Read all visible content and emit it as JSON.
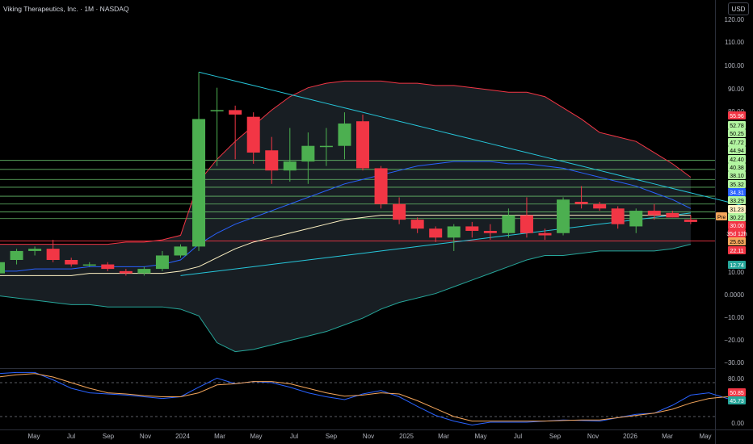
{
  "header": {
    "title": "Viking Therapeutics, Inc. · 1M · NASDAQ",
    "currency_label": "USD"
  },
  "price_axis": {
    "ticks": [
      "120.00",
      "110.00",
      "100.00",
      "90.00",
      "80.00",
      "10.00",
      "0.0000",
      "−10.00",
      "−20.00",
      "−30.00"
    ],
    "levels": [
      {
        "label": "55.96",
        "value": 79.5,
        "color": "#f23645"
      },
      {
        "label": "52.78",
        "value": 76.0,
        "color": "#b2f5a0"
      },
      {
        "label": "50.25",
        "value": 73.0,
        "color": "#b2f5a0"
      },
      {
        "label": "47.72",
        "value": 70.0,
        "color": "#b2f5a0"
      },
      {
        "label": "44.94",
        "value": 66.0,
        "color": "#b2f5a0"
      },
      {
        "label": "42.40",
        "value": 62.5,
        "color": "#b2f5a0"
      },
      {
        "label": "40.38",
        "value": 59.2,
        "color": "#b2f5a0"
      },
      {
        "label": "38.10",
        "value": 55.7,
        "color": "#b2f5a0"
      },
      {
        "label": "35.32",
        "value": 52.3,
        "color": "#b2f5a0"
      },
      {
        "label": "34.31",
        "value": 48.8,
        "color": "#2962ff"
      },
      {
        "label": "33.29",
        "value": 45.3,
        "color": "#b2f5a0"
      },
      {
        "label": "31.23",
        "value": 41.8,
        "color": "#fff3c4"
      },
      {
        "label": "30.22",
        "value": 38.0,
        "color": "#b2f5a0"
      },
      {
        "label": "30.00",
        "value": 35.0,
        "color": "#f23645"
      },
      {
        "label": "35d 12h",
        "value": 32.0,
        "color": "#f23645"
      },
      {
        "label": "25.63",
        "value": 28.0,
        "color": "#f5a65b"
      },
      {
        "label": "22.11",
        "value": 23.5,
        "color": "#f23645"
      },
      {
        "label": "12.74",
        "value": 13.5,
        "color": "#26a69a"
      }
    ],
    "pre_label": "Pre"
  },
  "oscillator_axis": {
    "ticks": [
      "80.00",
      "0.00"
    ],
    "levels": [
      {
        "label": "50.85",
        "color": "#f23645"
      },
      {
        "label": "45.73",
        "color": "#26a69a"
      }
    ]
  },
  "time_axis": {
    "labels": [
      "May",
      "Jul",
      "Sep",
      "Nov",
      "2024",
      "Mar",
      "May",
      "Jul",
      "Sep",
      "Nov",
      "2025",
      "Mar",
      "May",
      "Jul",
      "Sep",
      "Nov",
      "2026",
      "Mar",
      "May"
    ]
  },
  "chart_data": {
    "type": "candlestick",
    "title": "Viking Therapeutics, Inc. · 1M · NASDAQ",
    "currency": "USD",
    "timeframe": "1M",
    "ylim": [
      -33,
      124
    ],
    "candles": [
      {
        "x": "2023-03",
        "o": 9,
        "h": 16,
        "l": 8,
        "c": 14
      },
      {
        "x": "2023-04",
        "o": 15,
        "h": 20,
        "l": 13,
        "c": 19
      },
      {
        "x": "2023-05",
        "o": 19,
        "h": 21,
        "l": 17,
        "c": 20
      },
      {
        "x": "2023-06",
        "o": 20,
        "h": 24,
        "l": 14,
        "c": 15
      },
      {
        "x": "2023-07",
        "o": 15,
        "h": 16,
        "l": 12,
        "c": 13
      },
      {
        "x": "2023-08",
        "o": 13,
        "h": 14,
        "l": 12,
        "c": 13
      },
      {
        "x": "2023-09",
        "o": 13,
        "h": 14,
        "l": 10,
        "c": 11
      },
      {
        "x": "2023-10",
        "o": 10,
        "h": 11,
        "l": 8,
        "c": 9
      },
      {
        "x": "2023-11",
        "o": 9,
        "h": 12,
        "l": 8,
        "c": 11
      },
      {
        "x": "2023-12",
        "o": 11,
        "h": 19,
        "l": 10,
        "c": 17
      },
      {
        "x": "2024-01",
        "o": 17,
        "h": 22,
        "l": 16,
        "c": 21
      },
      {
        "x": "2024-02",
        "o": 21,
        "h": 99,
        "l": 19,
        "c": 78
      },
      {
        "x": "2024-03",
        "o": 82,
        "h": 92,
        "l": 57,
        "c": 82
      },
      {
        "x": "2024-04",
        "o": 82,
        "h": 84,
        "l": 60,
        "c": 80
      },
      {
        "x": "2024-05",
        "o": 79,
        "h": 81,
        "l": 58,
        "c": 63
      },
      {
        "x": "2024-06",
        "o": 64,
        "h": 70,
        "l": 49,
        "c": 55
      },
      {
        "x": "2024-07",
        "o": 55,
        "h": 74,
        "l": 50,
        "c": 59
      },
      {
        "x": "2024-08",
        "o": 59,
        "h": 72,
        "l": 49,
        "c": 66
      },
      {
        "x": "2024-09",
        "o": 66,
        "h": 74,
        "l": 57,
        "c": 66
      },
      {
        "x": "2024-10",
        "o": 66,
        "h": 81,
        "l": 60,
        "c": 76
      },
      {
        "x": "2024-11",
        "o": 77,
        "h": 80,
        "l": 55,
        "c": 56
      },
      {
        "x": "2024-12",
        "o": 56,
        "h": 57,
        "l": 38,
        "c": 40
      },
      {
        "x": "2025-01",
        "o": 40,
        "h": 43,
        "l": 31,
        "c": 33
      },
      {
        "x": "2025-02",
        "o": 33,
        "h": 34,
        "l": 27,
        "c": 29
      },
      {
        "x": "2025-03",
        "o": 29,
        "h": 30,
        "l": 23,
        "c": 25
      },
      {
        "x": "2025-04",
        "o": 25,
        "h": 31,
        "l": 19,
        "c": 30
      },
      {
        "x": "2025-05",
        "o": 30,
        "h": 32,
        "l": 25,
        "c": 28
      },
      {
        "x": "2025-06",
        "o": 28,
        "h": 31,
        "l": 24,
        "c": 27
      },
      {
        "x": "2025-07",
        "o": 27,
        "h": 38,
        "l": 25,
        "c": 35
      },
      {
        "x": "2025-08",
        "o": 35,
        "h": 43,
        "l": 25,
        "c": 27
      },
      {
        "x": "2025-09",
        "o": 27,
        "h": 29,
        "l": 24,
        "c": 26
      },
      {
        "x": "2025-10",
        "o": 27,
        "h": 43,
        "l": 26,
        "c": 42
      },
      {
        "x": "2025-11",
        "o": 41,
        "h": 48,
        "l": 38,
        "c": 40
      },
      {
        "x": "2025-12",
        "o": 40,
        "h": 41,
        "l": 37,
        "c": 38
      },
      {
        "x": "2026-01",
        "o": 38,
        "h": 39,
        "l": 29,
        "c": 31
      },
      {
        "x": "2026-02",
        "o": 30,
        "h": 38,
        "l": 27,
        "c": 37
      },
      {
        "x": "2026-03",
        "o": 37,
        "h": 40,
        "l": 33,
        "c": 35
      },
      {
        "x": "2026-04",
        "o": 36,
        "h": 37,
        "l": 34,
        "c": 34
      },
      {
        "x": "2026-05",
        "o": 33,
        "h": 35,
        "l": 31,
        "c": 32
      }
    ],
    "series": [
      {
        "name": "bb_upper",
        "color": "#f23645",
        "values": [
          22,
          22,
          22,
          22,
          22,
          22,
          22,
          23,
          23,
          24,
          26,
          50,
          60,
          68,
          75,
          82,
          88,
          92,
          94,
          95,
          95,
          95,
          94,
          94,
          93,
          93,
          92,
          91,
          90,
          90,
          88,
          83,
          78,
          72,
          70,
          68,
          63,
          58,
          52
        ]
      },
      {
        "name": "bb_basis",
        "color": "#2962ff",
        "values": [
          10,
          10,
          11,
          11,
          11,
          12,
          12,
          12,
          12,
          13,
          15,
          22,
          27,
          31,
          34,
          37,
          40,
          43,
          46,
          49,
          51,
          53,
          55,
          57,
          58,
          59,
          59,
          59,
          58,
          58,
          57,
          56,
          54,
          52,
          50,
          48,
          45,
          42,
          38
        ]
      },
      {
        "name": "bb_lower",
        "color": "#26a69a",
        "values": [
          -1,
          -2,
          -3,
          -4,
          -5,
          -5,
          -6,
          -6,
          -6,
          -6,
          -7,
          -10,
          -22,
          -26,
          -25,
          -23,
          -21,
          -19,
          -17,
          -14,
          -11,
          -7,
          -4,
          -2,
          0,
          3,
          6,
          9,
          12,
          15,
          17,
          17,
          18,
          19,
          19,
          19,
          19,
          20,
          22
        ]
      },
      {
        "name": "ma_yellow",
        "color": "#fff3c4",
        "values": [
          8,
          8,
          8,
          8,
          8,
          9,
          9,
          9,
          9,
          9,
          10,
          12,
          16,
          20,
          23,
          25,
          27,
          29,
          31,
          33,
          34,
          35,
          35,
          35,
          35,
          35,
          35,
          35,
          35,
          35,
          35,
          35,
          35,
          35,
          35,
          35,
          35,
          35,
          35
        ]
      },
      {
        "name": "trend_upper",
        "color": "#26c6da",
        "values": [
          99,
          97,
          95,
          93,
          91,
          89,
          87,
          85,
          83,
          81,
          79,
          77,
          75,
          73,
          71,
          69,
          67,
          65,
          63,
          61,
          59,
          57,
          55,
          53,
          51,
          49,
          47,
          45,
          43,
          41,
          39
        ]
      },
      {
        "name": "trend_lower",
        "color": "#26c6da",
        "values": [
          8,
          9,
          10,
          11,
          12,
          13,
          14,
          15,
          16,
          17,
          18,
          19,
          20,
          21,
          22,
          23,
          24,
          25,
          26,
          27,
          28,
          29,
          30,
          31,
          32,
          33,
          34,
          35,
          36
        ]
      }
    ],
    "oscillator": {
      "ylim": [
        0,
        100
      ],
      "series": [
        {
          "name": "k",
          "color": "#2962ff",
          "values": [
            96,
            98,
            98,
            85,
            70,
            62,
            60,
            58,
            55,
            52,
            55,
            72,
            88,
            78,
            82,
            80,
            72,
            62,
            55,
            50,
            60,
            66,
            55,
            38,
            22,
            12,
            5,
            10,
            10,
            10,
            12,
            14,
            13,
            12,
            18,
            24,
            26,
            40,
            58,
            62,
            52,
            48
          ]
        },
        {
          "name": "d",
          "color": "#f5a65b",
          "values": [
            90,
            94,
            96,
            90,
            80,
            70,
            62,
            60,
            57,
            55,
            55,
            62,
            76,
            78,
            82,
            82,
            78,
            70,
            62,
            56,
            58,
            62,
            60,
            48,
            34,
            20,
            12,
            12,
            12,
            12,
            12,
            13,
            14,
            14,
            18,
            22,
            26,
            33,
            44,
            52,
            55,
            51
          ]
        }
      ]
    }
  }
}
